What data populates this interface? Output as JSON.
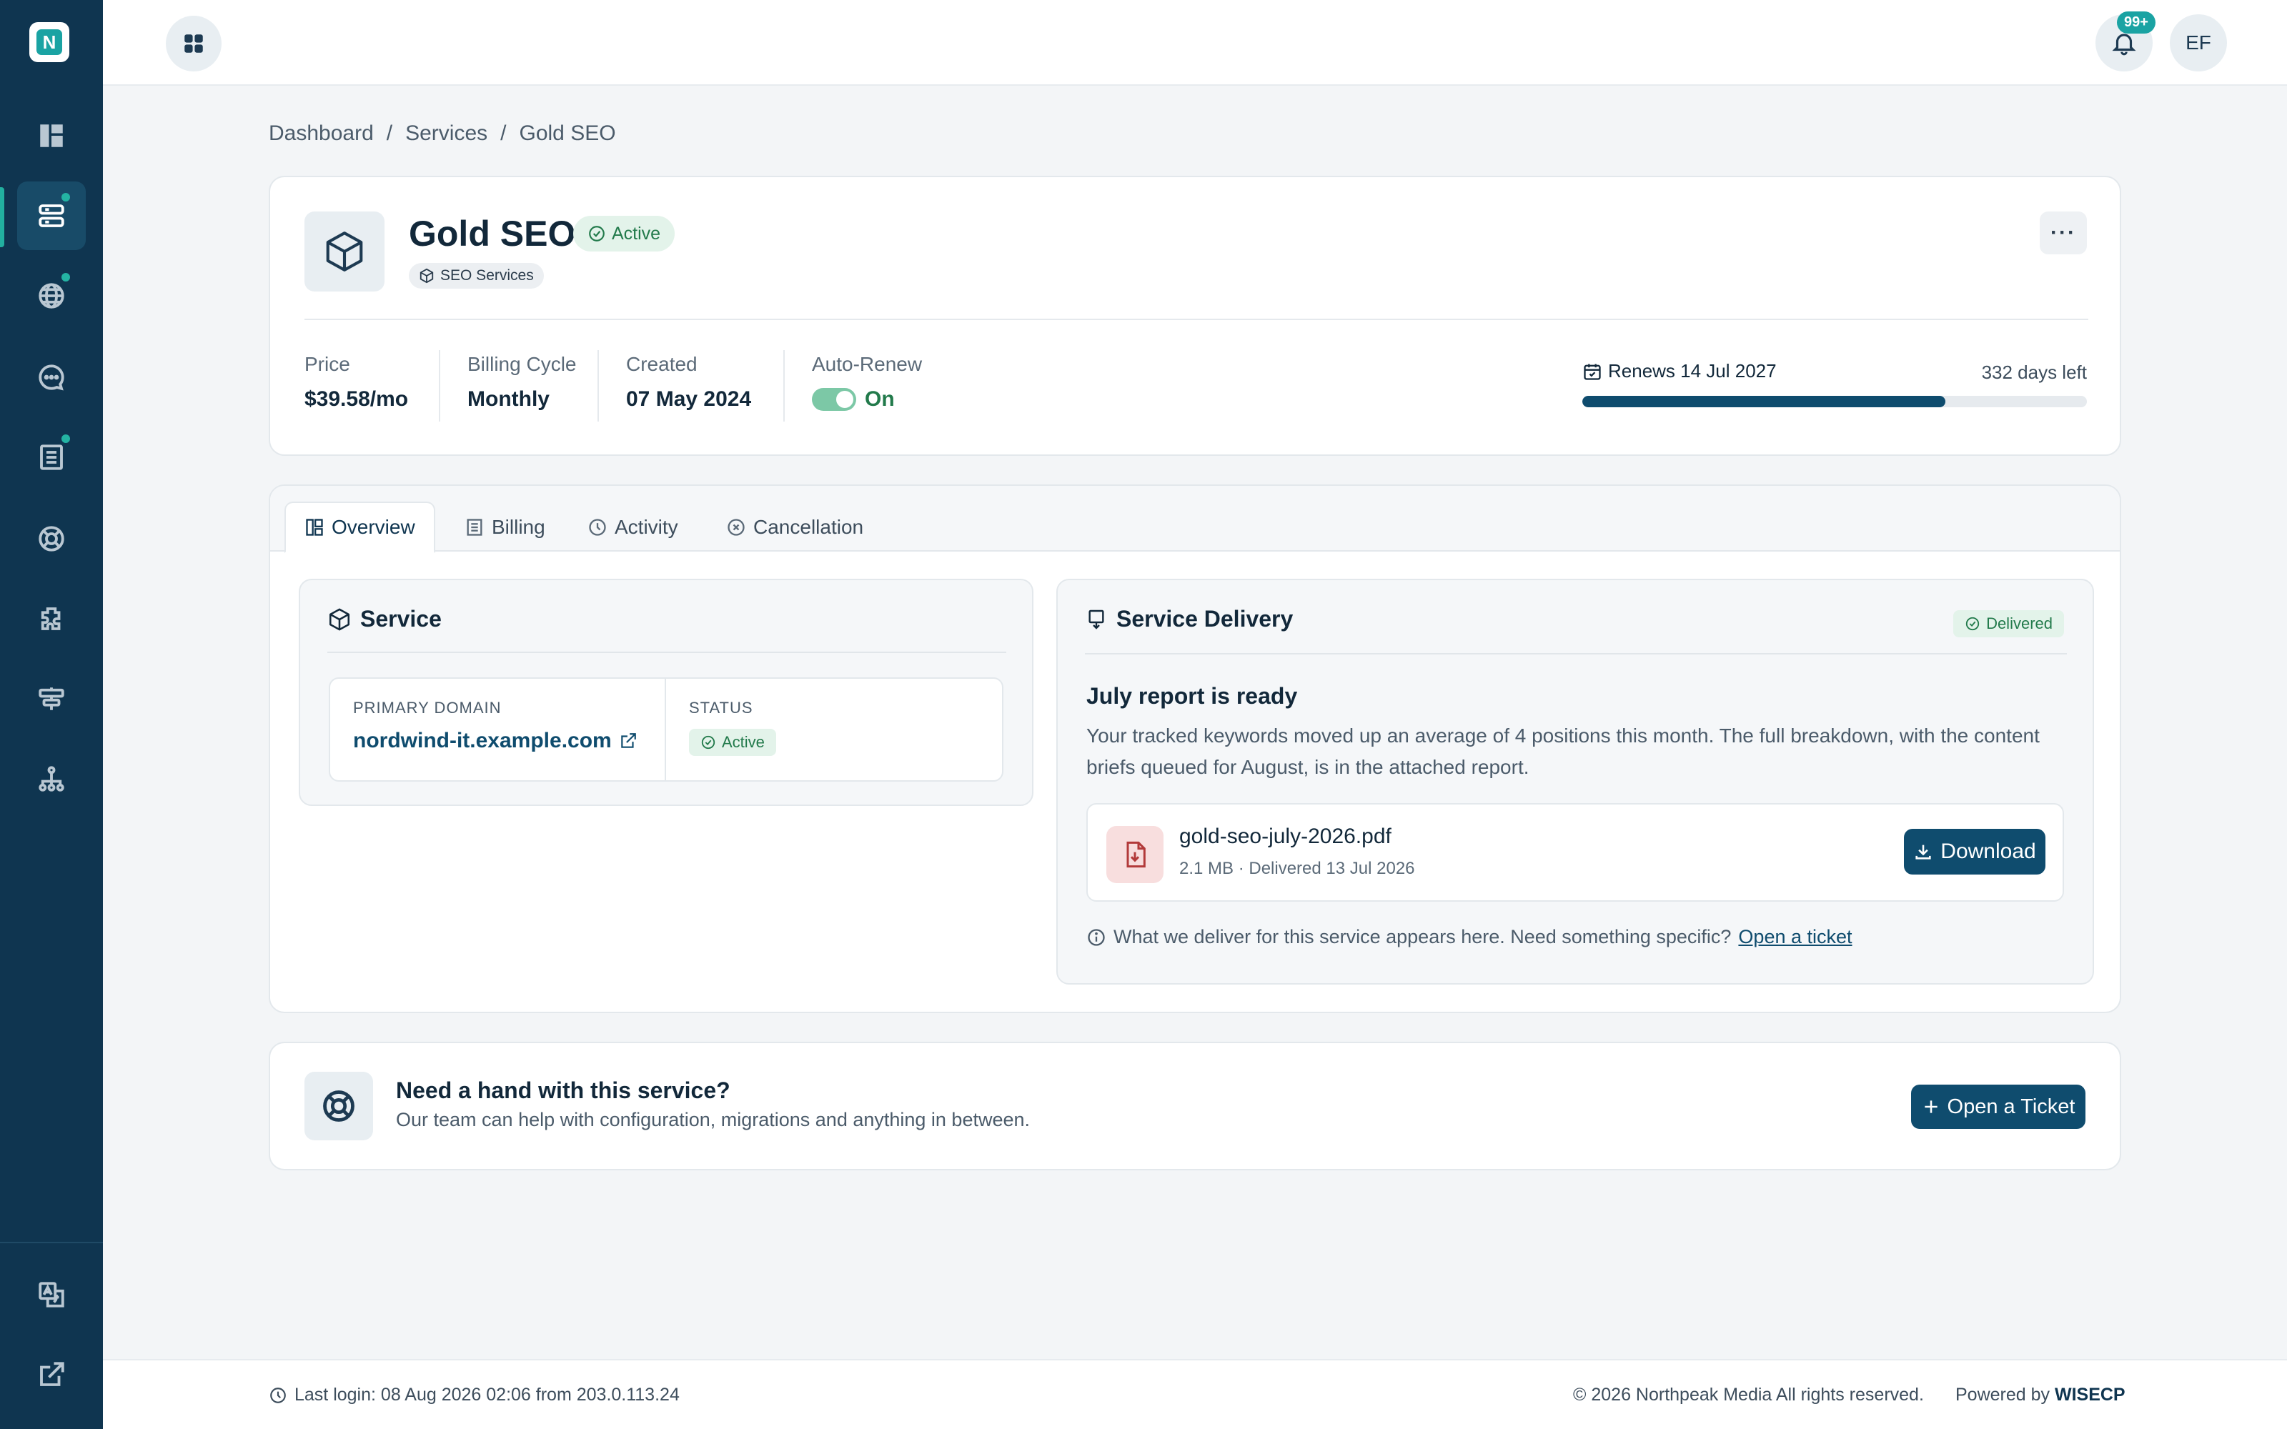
{
  "app": {
    "logo_letter": "N",
    "notifications_count": "99+",
    "user_initials": "EF"
  },
  "sidebar": {
    "items": [
      {
        "icon": "dashboard-icon",
        "active": false
      },
      {
        "icon": "services-icon",
        "active": true,
        "dot": true
      },
      {
        "icon": "globe-icon",
        "active": false,
        "dot": true
      },
      {
        "icon": "chat-icon",
        "active": false
      },
      {
        "icon": "invoice-icon",
        "active": false,
        "dot": true
      },
      {
        "icon": "support-icon",
        "active": false
      },
      {
        "icon": "plugin-icon",
        "active": false
      },
      {
        "icon": "signpost-icon",
        "active": false
      },
      {
        "icon": "sitemap-icon",
        "active": false
      }
    ],
    "bottom_items": [
      {
        "icon": "translate-icon"
      },
      {
        "icon": "external-link-icon"
      }
    ]
  },
  "breadcrumb": {
    "items": [
      "Dashboard",
      "Services",
      "Gold SEO"
    ],
    "separator": "/"
  },
  "service": {
    "name": "Gold SEO",
    "status": "Active",
    "category": "SEO Services",
    "more_label": "···",
    "price_label": "Price",
    "price_value": "$39.58/mo",
    "billing_label": "Billing Cycle",
    "billing_value": "Monthly",
    "created_label": "Created",
    "created_value": "07 May 2024",
    "autorenew_label": "Auto-Renew",
    "autorenew_value": "On",
    "renews": "Renews 14 Jul 2027",
    "days_left": "332 days left",
    "renew_progress": 0.72
  },
  "tabs": [
    {
      "label": "Overview",
      "icon": "overview-icon",
      "active": true
    },
    {
      "label": "Billing",
      "icon": "billing-icon",
      "active": false
    },
    {
      "label": "Activity",
      "icon": "clock-icon",
      "active": false
    },
    {
      "label": "Cancellation",
      "icon": "x-circle-icon",
      "active": false
    }
  ],
  "overview": {
    "service_title": "Service",
    "primary_domain_label": "PRIMARY DOMAIN",
    "primary_domain": "nordwind-it.example.com",
    "status_label": "STATUS",
    "status_value": "Active"
  },
  "delivery": {
    "title": "Service Delivery",
    "badge": "Delivered",
    "report_title": "July report is ready",
    "report_text": "Your tracked keywords moved up an average of 4 positions this month. The full breakdown, with the content briefs queued for August, is in the attached report.",
    "file_name": "gold-seo-july-2026.pdf",
    "file_meta": "2.1 MB · Delivered 13 Jul 2026",
    "download_label": "Download",
    "note": "What we deliver for this service appears here. Need something specific?",
    "note_link": "Open a ticket"
  },
  "help": {
    "title": "Need a hand with this service?",
    "subtitle": "Our team can help with configuration, migrations and anything in between.",
    "button": "Open a Ticket"
  },
  "footer": {
    "last_login": "Last login: 08 Aug 2026 02:06 from 203.0.113.24",
    "copyright": "© 2026 Northpeak Media All rights reserved.",
    "powered_prefix": "Powered by",
    "powered_brand": "WISECP"
  },
  "colors": {
    "sidebar": "#0f3550",
    "accent": "#1aa3a3",
    "primary_button": "#0f4c6e",
    "success": "#227a4b"
  }
}
